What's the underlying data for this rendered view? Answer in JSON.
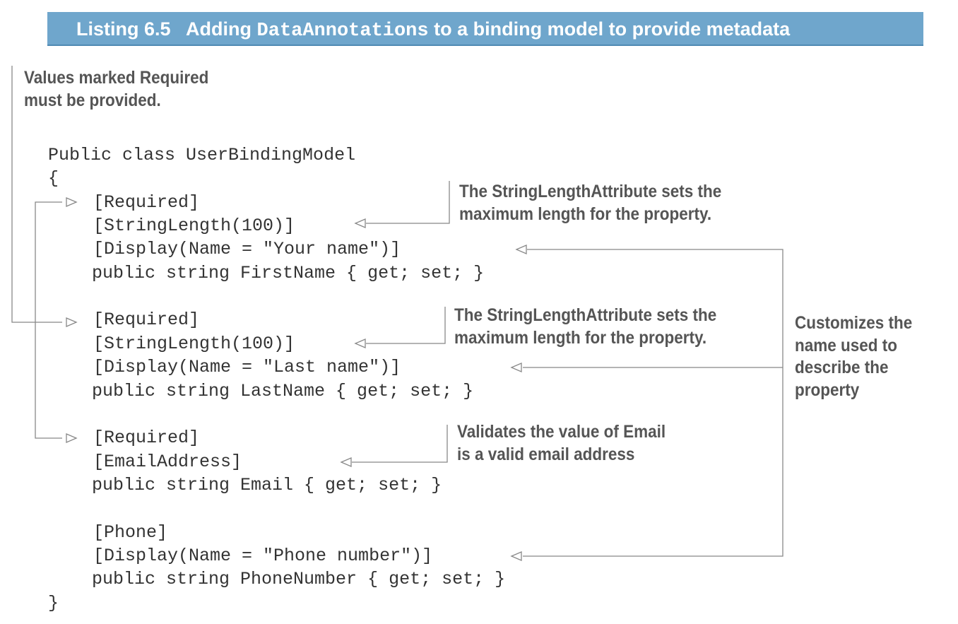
{
  "listing": {
    "number": "Listing 6.5",
    "title_prefix": "Adding",
    "title_code": "DataAnnotations",
    "title_suffix": "to a binding model to provide metadata"
  },
  "annotations": {
    "required": [
      "Values marked Required",
      "must be provided."
    ],
    "stringlength_1": [
      "The StringLengthAttribute sets the",
      "maximum length for the property."
    ],
    "stringlength_2": [
      "The StringLengthAttribute sets the",
      "maximum length for the property."
    ],
    "email": [
      "Validates the value of Email",
      "is a valid email address"
    ],
    "display": [
      "Customizes the",
      "name used to",
      "describe the",
      "property"
    ]
  },
  "code": [
    "Public class UserBindingModel",
    "{",
    "[Required]",
    "[StringLength(100)]",
    "[Display(Name = \"Your name\")]",
    "public string FirstName { get; set; }",
    "[Required]",
    "[StringLength(100)]",
    "[Display(Name = \"Last name\")]",
    "public string LastName { get; set; }",
    "[Required]",
    "[EmailAddress]",
    "public string Email { get; set; }",
    "[Phone]",
    "[Display(Name = \"Phone number\")]",
    "public string PhoneNumber { get; set; }",
    "}"
  ],
  "colors": {
    "title_bar": "#6fa6cc",
    "annotation_text": "#555555",
    "code_text": "#333333",
    "connector": "#888888"
  }
}
